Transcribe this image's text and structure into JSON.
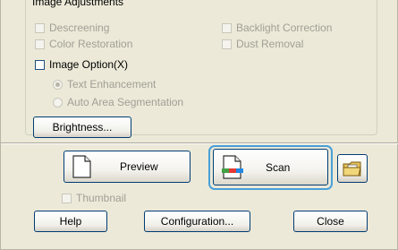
{
  "group": {
    "title": "Image Adjustments"
  },
  "options": {
    "descreening": "Descreening",
    "backlight": "Backlight Correction",
    "color_restoration": "Color Restoration",
    "dust_removal": "Dust Removal",
    "image_option": "Image Option(X)",
    "text_enhancement": "Text Enhancement",
    "auto_area": "Auto Area Segmentation",
    "brightness": "Brightness..."
  },
  "buttons": {
    "preview": "Preview",
    "scan": "Scan",
    "thumbnail": "Thumbnail",
    "help": "Help",
    "configuration": "Configuration...",
    "close": "Close"
  },
  "colors": {
    "focus": "#4aa0d8",
    "dialog_bg": "#ece9d8",
    "button_border": "#003c74"
  }
}
